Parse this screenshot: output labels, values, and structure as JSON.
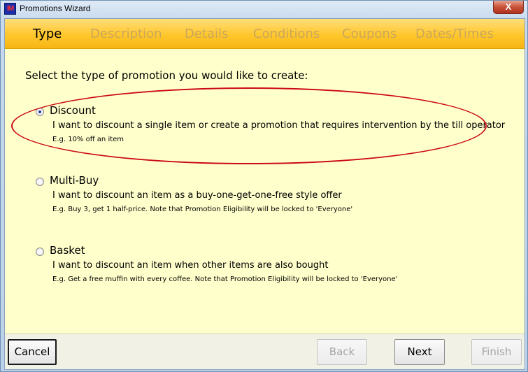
{
  "window": {
    "title": "Promotions Wizard",
    "close_symbol": "X",
    "icon_text": "IM"
  },
  "steps": [
    {
      "label": "Type",
      "active": true
    },
    {
      "label": "Description",
      "active": false
    },
    {
      "label": "Details",
      "active": false
    },
    {
      "label": "Conditions",
      "active": false
    },
    {
      "label": "Coupons",
      "active": false
    },
    {
      "label": "Dates/Times",
      "active": false
    }
  ],
  "main": {
    "prompt": "Select the type of promotion you would like to create:",
    "options": [
      {
        "label": "Discount",
        "selected": true,
        "description": "I want to discount a single item or create a promotion that requires intervention by the till operator",
        "example": "E.g. 10% off an item"
      },
      {
        "label": "Multi-Buy",
        "selected": false,
        "description": "I want to discount an item as a buy-one-get-one-free style offer",
        "example": "E.g. Buy 3, get 1 half-price.  Note that Promotion Eligibility will be locked to 'Everyone'"
      },
      {
        "label": "Basket",
        "selected": false,
        "description": "I want to discount an item when other items are also bought",
        "example": "E.g. Get a free muffin with every coffee.  Note that Promotion Eligibility will be locked to 'Everyone'"
      }
    ]
  },
  "buttons": {
    "cancel": "Cancel",
    "back": "Back",
    "next": "Next",
    "finish": "Finish"
  },
  "colors": {
    "client_background": "#ffffcc",
    "stepbar_accent": "#ffc72c",
    "annotation_ellipse": "#cc0a14"
  }
}
